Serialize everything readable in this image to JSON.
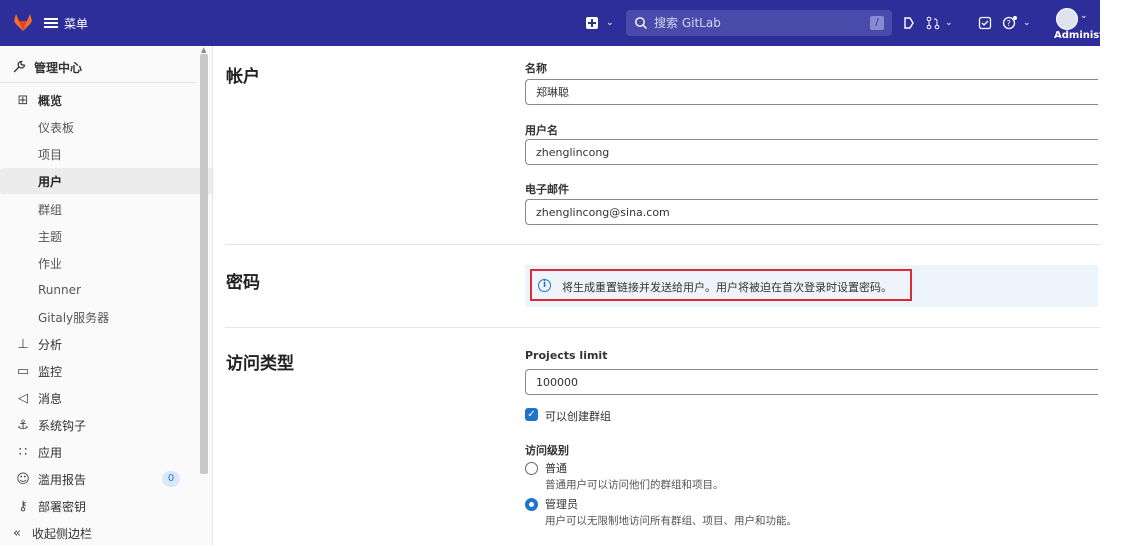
{
  "topbar": {
    "menu_label": "菜单",
    "search_placeholder": "搜索 GitLab",
    "search_shortcut": "/",
    "user_name": "Administr"
  },
  "sidebar": {
    "header": "管理中心",
    "items": [
      {
        "label": "概览",
        "icon": "overview-icon"
      },
      {
        "label": "仪表板"
      },
      {
        "label": "项目"
      },
      {
        "label": "用户"
      },
      {
        "label": "群组"
      },
      {
        "label": "主题"
      },
      {
        "label": "作业"
      },
      {
        "label": "Runner"
      },
      {
        "label": "Gitaly服务器"
      },
      {
        "label": "分析",
        "icon": "analytics-icon"
      },
      {
        "label": "监控",
        "icon": "monitor-icon"
      },
      {
        "label": "消息",
        "icon": "megaphone-icon"
      },
      {
        "label": "系统钩子",
        "icon": "anchor-icon"
      },
      {
        "label": "应用",
        "icon": "apps-icon"
      },
      {
        "label": "滥用报告",
        "icon": "smiley-icon",
        "badge": "0"
      },
      {
        "label": "部署密钥",
        "icon": "key-icon"
      },
      {
        "label": "收起侧边栏",
        "icon": "collapse-icon"
      }
    ]
  },
  "account": {
    "title": "帐户",
    "name_label": "名称",
    "name_value": "郑琳聪",
    "username_label": "用户名",
    "username_value": "zhenglincong",
    "email_label": "电子邮件",
    "email_value": "zhenglincong@sina.com"
  },
  "password": {
    "title": "密码",
    "alert": "将生成重置链接并发送给用户。用户将被迫在首次登录时设置密码。"
  },
  "access": {
    "title": "访问类型",
    "projects_limit_label": "Projects limit",
    "projects_limit_value": "100000",
    "can_create_group_label": "可以创建群组",
    "can_create_group_checked": true,
    "level_label": "访问级别",
    "levels": [
      {
        "label": "普通",
        "help": "普通用户可以访问他们的群组和项目。",
        "selected": false
      },
      {
        "label": "管理员",
        "help": "用户可以无限制地访问所有群组、项目、用户和功能。",
        "selected": true
      }
    ]
  },
  "colors": {
    "topbar": "#2e2e9a",
    "accent": "#1f75cb",
    "highlight_border": "#dd2b36"
  }
}
